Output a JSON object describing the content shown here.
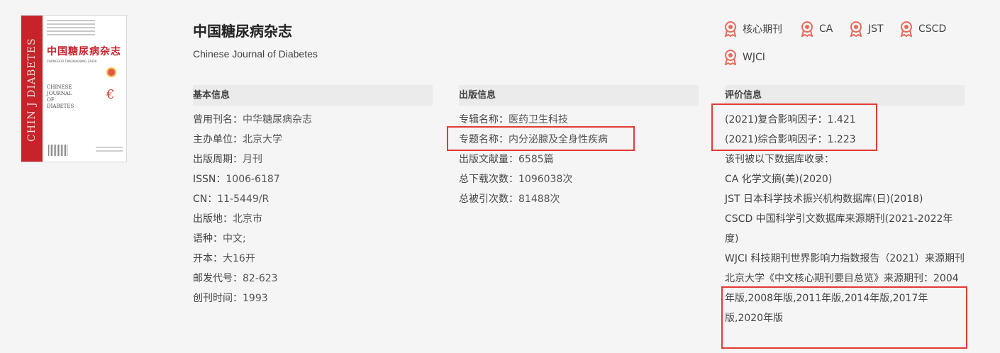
{
  "journal": {
    "cover": {
      "spine_text": "CHIN J DIABETES",
      "cn_title": "中国糖尿病杂志",
      "pinyin": "ZHONGGUO TANGNIAOBING ZAZHI",
      "en_title_lines": [
        "CHINESE",
        "JOURNAL",
        "OF",
        "DIABETES"
      ]
    },
    "title": "中国糖尿病杂志",
    "subtitle": "Chinese Journal of Diabetes",
    "badges": [
      "核心期刊",
      "CA",
      "JST",
      "CSCD",
      "WJCI"
    ]
  },
  "basic": {
    "header": "基本信息",
    "rows": [
      {
        "k": "曾用刊名：",
        "v": "中华糖尿病杂志"
      },
      {
        "k": "主办单位：",
        "v": "北京大学"
      },
      {
        "k": "出版周期：",
        "v": "月刊"
      },
      {
        "k": "ISSN：",
        "v": "1006-6187"
      },
      {
        "k": "CN：",
        "v": "11-5449/R"
      },
      {
        "k": "出版地：",
        "v": "北京市"
      },
      {
        "k": "语种：",
        "v": "中文;"
      },
      {
        "k": "开本：",
        "v": "大16开"
      },
      {
        "k": "邮发代号：",
        "v": "82-623"
      },
      {
        "k": "创刊时间：",
        "v": "1993"
      }
    ]
  },
  "publish": {
    "header": "出版信息",
    "rows": [
      {
        "k": "专辑名称：",
        "v": "医药卫生科技"
      },
      {
        "k": "专题名称：",
        "v": "内分泌腺及全身性疾病"
      },
      {
        "k": "出版文献量：",
        "v": "6585篇"
      },
      {
        "k": "总下载次数：",
        "v": "1096038次"
      },
      {
        "k": "总被引次数：",
        "v": "81488次"
      }
    ]
  },
  "evaluation": {
    "header": "评价信息",
    "impact_composite": "(2021)复合影响因子：1.421",
    "impact_comprehensive": "(2021)综合影响因子：1.223",
    "db_intro": "该刊被以下数据库收录：",
    "databases": [
      "CA 化学文摘(美)(2020)",
      "JST 日本科学技术振兴机构数据库(日)(2018)",
      "CSCD 中国科学引文数据库来源期刊(2021-2022年度)",
      "WJCI 科技期刊世界影响力指数报告（2021）来源期刊"
    ],
    "pku_core": "北京大学《中文核心期刊要目总览》来源期刊：2004年版,2008年版,2011年版,2014年版,2017年版,2020年版"
  },
  "colors": {
    "highlight": "#e53935",
    "badge_icon": "#e86a5b",
    "header_bg": "#ebebeb"
  }
}
